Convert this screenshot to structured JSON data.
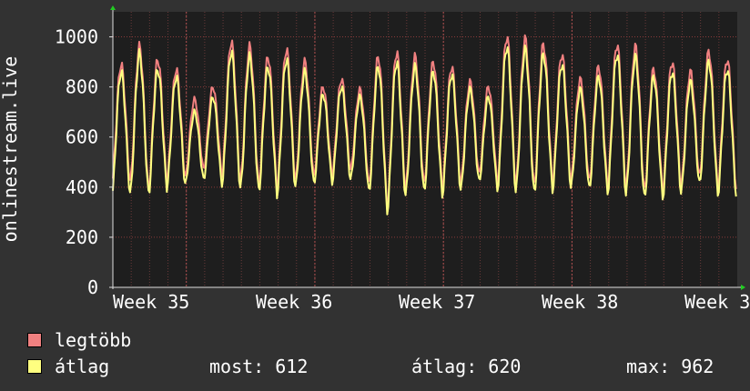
{
  "chart_data": {
    "type": "line",
    "title": "",
    "ylabel": "onlinestream.live",
    "ylim": [
      0,
      1100
    ],
    "yticks": [
      0,
      200,
      400,
      600,
      800,
      1000
    ],
    "x_labels": [
      "Week 35",
      "Week 36",
      "Week 37",
      "Week 38",
      "Week 3"
    ],
    "grid": true,
    "legend_position": "bottom-left",
    "background": "#1e1e1e",
    "series": [
      {
        "name": "legtöbb",
        "color": "#f08080",
        "daily": [
          [
            410,
            890
          ],
          [
            420,
            960
          ],
          [
            390,
            910
          ],
          [
            430,
            870
          ],
          [
            440,
            750
          ],
          [
            470,
            800
          ],
          [
            450,
            980
          ],
          [
            420,
            960
          ],
          [
            410,
            920
          ],
          [
            400,
            950
          ],
          [
            430,
            900
          ],
          [
            440,
            800
          ],
          [
            450,
            830
          ],
          [
            470,
            790
          ],
          [
            410,
            920
          ],
          [
            320,
            940
          ],
          [
            400,
            920
          ],
          [
            410,
            900
          ],
          [
            400,
            880
          ],
          [
            420,
            820
          ],
          [
            450,
            800
          ],
          [
            420,
            1000
          ],
          [
            410,
            990
          ],
          [
            400,
            970
          ],
          [
            420,
            930
          ],
          [
            430,
            830
          ],
          [
            420,
            880
          ],
          [
            410,
            970
          ],
          [
            400,
            960
          ],
          [
            380,
            870
          ],
          [
            390,
            900
          ],
          [
            410,
            860
          ],
          [
            440,
            940
          ],
          [
            400,
            910
          ]
        ]
      },
      {
        "name": "átlag",
        "color": "#ffff80",
        "daily": [
          [
            360,
            860
          ],
          [
            370,
            930
          ],
          [
            370,
            870
          ],
          [
            400,
            840
          ],
          [
            410,
            700
          ],
          [
            430,
            760
          ],
          [
            410,
            940
          ],
          [
            390,
            920
          ],
          [
            380,
            880
          ],
          [
            370,
            910
          ],
          [
            400,
            860
          ],
          [
            410,
            770
          ],
          [
            420,
            800
          ],
          [
            430,
            760
          ],
          [
            380,
            880
          ],
          [
            300,
            900
          ],
          [
            370,
            880
          ],
          [
            380,
            860
          ],
          [
            370,
            850
          ],
          [
            390,
            790
          ],
          [
            420,
            760
          ],
          [
            390,
            960
          ],
          [
            380,
            950
          ],
          [
            370,
            930
          ],
          [
            390,
            890
          ],
          [
            400,
            790
          ],
          [
            390,
            840
          ],
          [
            380,
            930
          ],
          [
            370,
            920
          ],
          [
            350,
            840
          ],
          [
            360,
            860
          ],
          [
            380,
            820
          ],
          [
            410,
            900
          ],
          [
            370,
            870
          ]
        ]
      }
    ],
    "current_value": 612,
    "legend_stats": {
      "most_label": "most:",
      "most_value": "612",
      "avg_label": "átlag:",
      "avg_value": "620",
      "max_label": "max:",
      "max_value": "962"
    }
  }
}
